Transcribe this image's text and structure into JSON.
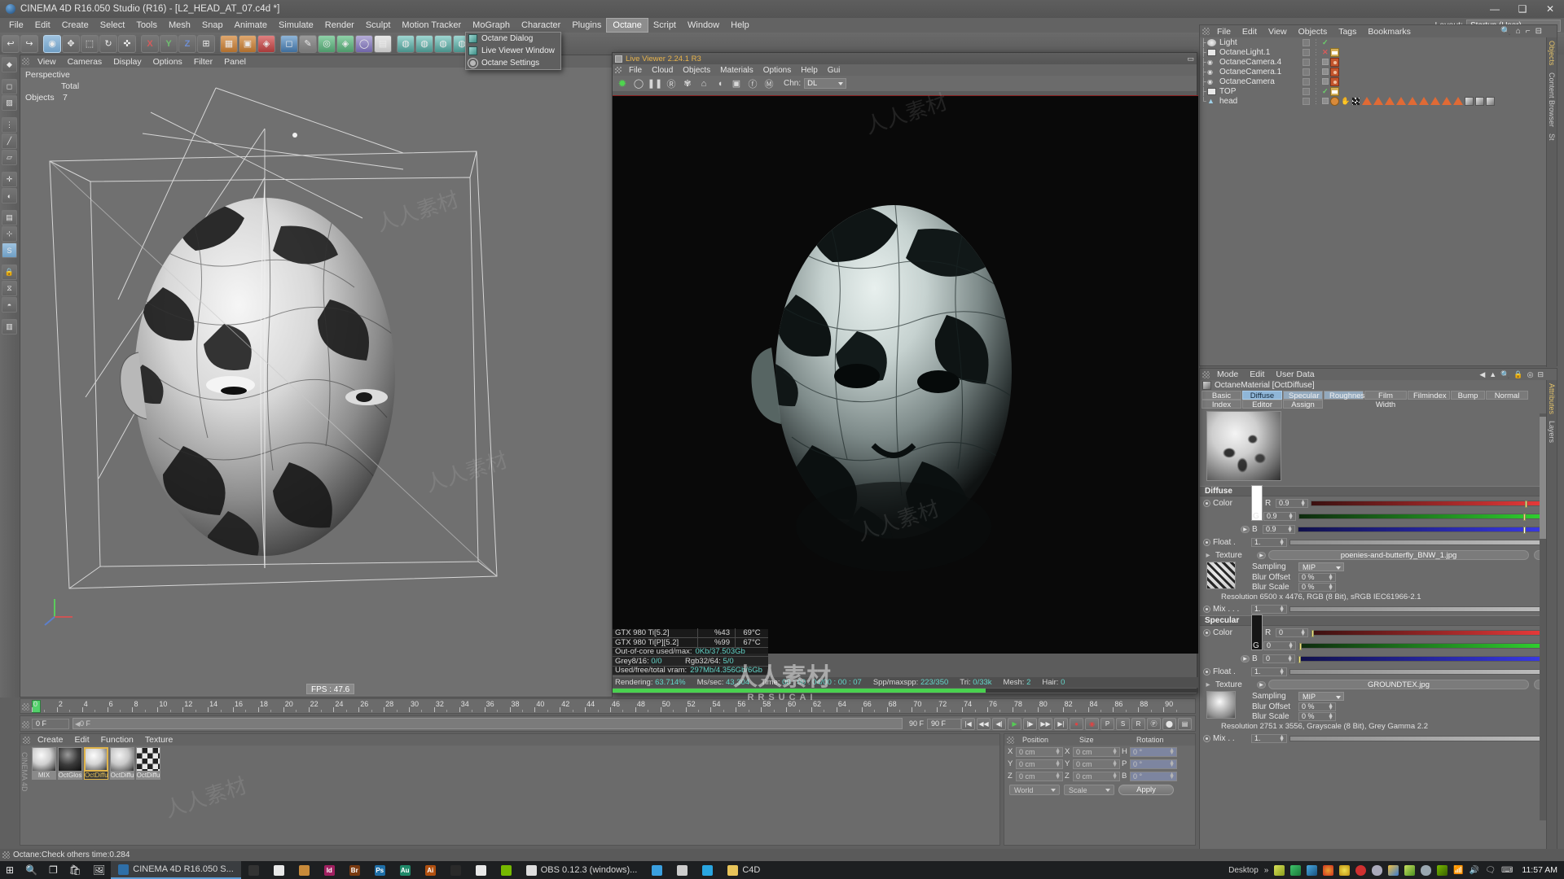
{
  "window": {
    "title": "CINEMA 4D R16.050 Studio (R16) - [L2_HEAD_AT_07.c4d *]",
    "minimize": "—",
    "maximize": "❑",
    "close": "✕"
  },
  "menubar": {
    "items": [
      "File",
      "Edit",
      "Create",
      "Select",
      "Tools",
      "Mesh",
      "Snap",
      "Animate",
      "Simulate",
      "Render",
      "Sculpt",
      "Motion Tracker",
      "MoGraph",
      "Character",
      "Plugins",
      "Octane",
      "Script",
      "Window",
      "Help"
    ],
    "active": "Octane",
    "layout_label": "Layout:",
    "layout_value": "Startup (User)"
  },
  "octane_menu": {
    "items": [
      {
        "label": "Octane Dialog",
        "icon": "octane-icon"
      },
      {
        "label": "Live Viewer Window",
        "icon": "octane-icon"
      },
      {
        "label": "Octane Settings",
        "icon": "gear-icon"
      }
    ]
  },
  "viewport": {
    "menu": [
      "View",
      "Cameras",
      "Display",
      "Options",
      "Filter",
      "Panel"
    ],
    "perspective_label": "Perspective",
    "total_label": "Total",
    "objects_label": "Objects",
    "objects_count": "7",
    "fps": "FPS : 47.6"
  },
  "live_viewer": {
    "title": "Live Viewer 2.24.1 R3",
    "menu": [
      "File",
      "Cloud",
      "Objects",
      "Materials",
      "Options",
      "Help",
      "Gui"
    ],
    "toolbar_icons": [
      "render-start-icon",
      "reload-icon",
      "pause-icon",
      "region-render-icon",
      "settings-icon",
      "lock-icon",
      "material-ball-icon",
      "picture-icon",
      "focus-picker-icon",
      "material-picker-icon"
    ],
    "chn_label": "Chn:",
    "chn_value": "DL",
    "gpu": [
      {
        "name": "GTX 980 Ti[5.2]",
        "usage": "%43",
        "temp": "69°C"
      },
      {
        "name": "GTX 980 Ti[P][5.2]",
        "usage": "%99",
        "temp": "67°C"
      }
    ],
    "ooc_label": "Out-of-core used/max:",
    "ooc_value": "0Kb/37.503Gb",
    "grey_label": "Grey8/16:",
    "grey_value": "0/0",
    "rgb_label": "Rgb32/64:",
    "rgb_value": "5/0",
    "vram_label": "Used/free/total vram:",
    "vram_value": "297Mb/4.356Gb/6Gb",
    "status": [
      {
        "label": "Rendering:",
        "value": "63.714%"
      },
      {
        "label": "Ms/sec:",
        "value": "43.304"
      },
      {
        "label": "Time:",
        "value": "00 : 00 : 04/00 : 00 : 07"
      },
      {
        "label": "Spp/maxspp:",
        "value": "223/350"
      },
      {
        "label": "Tri:",
        "value": "0/33k"
      },
      {
        "label": "Mesh:",
        "value": "2"
      },
      {
        "label": "Hair:",
        "value": "0"
      }
    ],
    "progress_percent": 63.714
  },
  "object_manager": {
    "menu": [
      "File",
      "Edit",
      "View",
      "Objects",
      "Tags",
      "Bookmarks"
    ],
    "icons": [
      "search-icon",
      "home-icon",
      "minus-icon",
      "layout-icon"
    ],
    "rows": [
      {
        "name": "Light",
        "icon": "light-icon",
        "visible": "✓"
      },
      {
        "name": "OctaneLight.1",
        "icon": "rect-icon",
        "visible": "✕"
      },
      {
        "name": "OctaneCamera.4",
        "icon": "camera-icon",
        "visible": "⬚"
      },
      {
        "name": "OctaneCamera.1",
        "icon": "camera-icon",
        "visible": "⬚"
      },
      {
        "name": "OctaneCamera",
        "icon": "camera-icon",
        "visible": "⬚"
      },
      {
        "name": "TOP",
        "icon": "rect-icon",
        "visible": "✓"
      },
      {
        "name": "head",
        "icon": "polygon-icon",
        "visible": ""
      }
    ],
    "side_tabs": [
      "Objects",
      "Content Browser",
      "St"
    ]
  },
  "attribute_manager": {
    "menu": [
      "Mode",
      "Edit",
      "User Data"
    ],
    "material_title": "OctaneMaterial [OctDiffuse]",
    "tabs_row1": [
      "Basic",
      "Diffuse",
      "Specular",
      "Roughness",
      "Film Width",
      "Filmindex",
      "Bump",
      "Normal"
    ],
    "tabs_row2": [
      "Index",
      "Editor",
      "Assign"
    ],
    "active_tabs": [
      "Diffuse",
      "Specular",
      "Roughness"
    ],
    "diffuse": {
      "section": "Diffuse",
      "color_label": "Color",
      "r_label": "R",
      "r_value": "0.9",
      "g_label": "G",
      "g_value": "0.9",
      "b_label": "B",
      "b_value": "0.9",
      "float_label": "Float .",
      "float_value": "1.",
      "texture_label": "Texture",
      "texture_value": "poenies-and-butterfly_BNW_1.jpg",
      "dots_label": "...",
      "sampling_label": "Sampling",
      "sampling_value": "MIP",
      "blur_offset_label": "Blur Offset",
      "blur_offset_value": "0 %",
      "blur_scale_label": "Blur Scale",
      "blur_scale_value": "0 %",
      "resolution": "Resolution 6500 x 4476, RGB (8 Bit), sRGB IEC61966-2.1",
      "mix_label": "Mix . . .",
      "mix_value": "1."
    },
    "specular": {
      "section": "Specular",
      "color_label": "Color",
      "r_label": "R",
      "r_value": "0",
      "g_label": "G",
      "g_value": "0",
      "b_label": "B",
      "b_value": "0",
      "float_label": "Float .",
      "float_value": "1.",
      "texture_label": "Texture",
      "texture_value": "GROUNDTEX.jpg",
      "dots_label": "...",
      "sampling_label": "Sampling",
      "sampling_value": "MIP",
      "blur_offset_label": "Blur Offset",
      "blur_offset_value": "0 %",
      "blur_scale_label": "Blur Scale",
      "blur_scale_value": "0 %",
      "resolution": "Resolution 2751 x 3556, Grayscale (8 Bit), Grey Gamma 2.2",
      "mix_label": "Mix . .",
      "mix_value": "1."
    },
    "side_tabs": [
      "Attributes",
      "Layers"
    ]
  },
  "timeline": {
    "ticks": [
      "0",
      "2",
      "4",
      "6",
      "8",
      "10",
      "12",
      "14",
      "16",
      "18",
      "20",
      "22",
      "24",
      "26",
      "28",
      "30",
      "32",
      "34",
      "36",
      "38",
      "40",
      "42",
      "44",
      "46",
      "48",
      "50",
      "52",
      "54",
      "56",
      "58",
      "60",
      "62",
      "64",
      "66",
      "68",
      "70",
      "72",
      "74",
      "76",
      "78",
      "80",
      "82",
      "84",
      "86",
      "88",
      "90"
    ],
    "current_frame": "0 F",
    "track_label": "0 F",
    "range_start": "0 F",
    "range_end": "90 F",
    "end_field": "90 F"
  },
  "material_manager": {
    "menu": [
      "Create",
      "Edit",
      "Function",
      "Texture"
    ],
    "materials": [
      {
        "name": "MIX",
        "selected": false
      },
      {
        "name": "OctGlos",
        "selected": false
      },
      {
        "name": "OctDiffu",
        "selected": true
      },
      {
        "name": "OctDiffu",
        "selected": false
      },
      {
        "name": "OctDiffu",
        "selected": false
      }
    ],
    "sidebar_text": "CINEMA 4D"
  },
  "coordinates": {
    "position_label": "Position",
    "size_label": "Size",
    "rotation_label": "Rotation",
    "rows": [
      {
        "axis1": "X",
        "v1": "0 cm",
        "axis2": "X",
        "v2": "0 cm",
        "axis3": "H",
        "v3": "0 °"
      },
      {
        "axis1": "Y",
        "v1": "0 cm",
        "axis2": "Y",
        "v2": "0 cm",
        "axis3": "P",
        "v3": "0 °"
      },
      {
        "axis1": "Z",
        "v1": "0 cm",
        "axis2": "Z",
        "v2": "0 cm",
        "axis3": "B",
        "v3": "0 °"
      }
    ],
    "world_value": "World",
    "scale_value": "Scale",
    "apply_label": "Apply"
  },
  "statusbar": {
    "text": "Octane:Check others time:0.284"
  },
  "taskbar": {
    "start_icon": "windows-start-icon",
    "search_icon": "search-icon",
    "taskview_icon": "task-view-icon",
    "store_icon": "store-icon",
    "photos_icon": "photos-icon",
    "apps": [
      {
        "label": "CINEMA 4D R16.050 S...",
        "icon": "c4d-icon",
        "active": true
      },
      {
        "label": "",
        "icon": "bridge-icon",
        "active": false
      },
      {
        "label": "",
        "icon": "chrome-icon",
        "active": false
      },
      {
        "label": "",
        "icon": "ap-icon",
        "active": false
      },
      {
        "label": "Id",
        "icon": "indesign-icon",
        "active": false
      },
      {
        "label": "Br",
        "icon": "bridge-app-icon",
        "active": false
      },
      {
        "label": "Ps",
        "icon": "photoshop-icon",
        "active": false
      },
      {
        "label": "Au",
        "icon": "audition-icon",
        "active": false
      },
      {
        "label": "Ai",
        "icon": "illustrator-icon",
        "active": false
      },
      {
        "label": "",
        "icon": "player-icon",
        "active": false
      },
      {
        "label": "",
        "icon": "skier-icon",
        "active": false
      },
      {
        "label": "",
        "icon": "nvidia-icon",
        "active": false
      },
      {
        "label": "OBS 0.12.3 (windows)...",
        "icon": "obs-icon",
        "active": false
      },
      {
        "label": "",
        "icon": "monitor-icon",
        "active": false
      },
      {
        "label": "",
        "icon": "disc-icon",
        "active": false
      },
      {
        "label": "",
        "icon": "skype-icon",
        "active": false
      },
      {
        "label": "C4D",
        "icon": "folder-icon",
        "active": false
      }
    ],
    "tray": {
      "desktop_label": "Desktop",
      "overflow": "»",
      "icons": [
        "dropbox-icon",
        "sync-icon",
        "autodesk-icon",
        "chrome-tray-icon",
        "disc-tray-icon",
        "red-target-icon",
        "link-icon",
        "chart-icon",
        "leaf-icon",
        "cloud-icon",
        "nvidia-tray-icon",
        "wifi-icon",
        "volume-icon",
        "action-center-icon",
        "keyboard-icon"
      ],
      "clock": "11:57 AM"
    }
  },
  "watermark": {
    "main": "人人素材",
    "sub": "RRSUCAI"
  }
}
